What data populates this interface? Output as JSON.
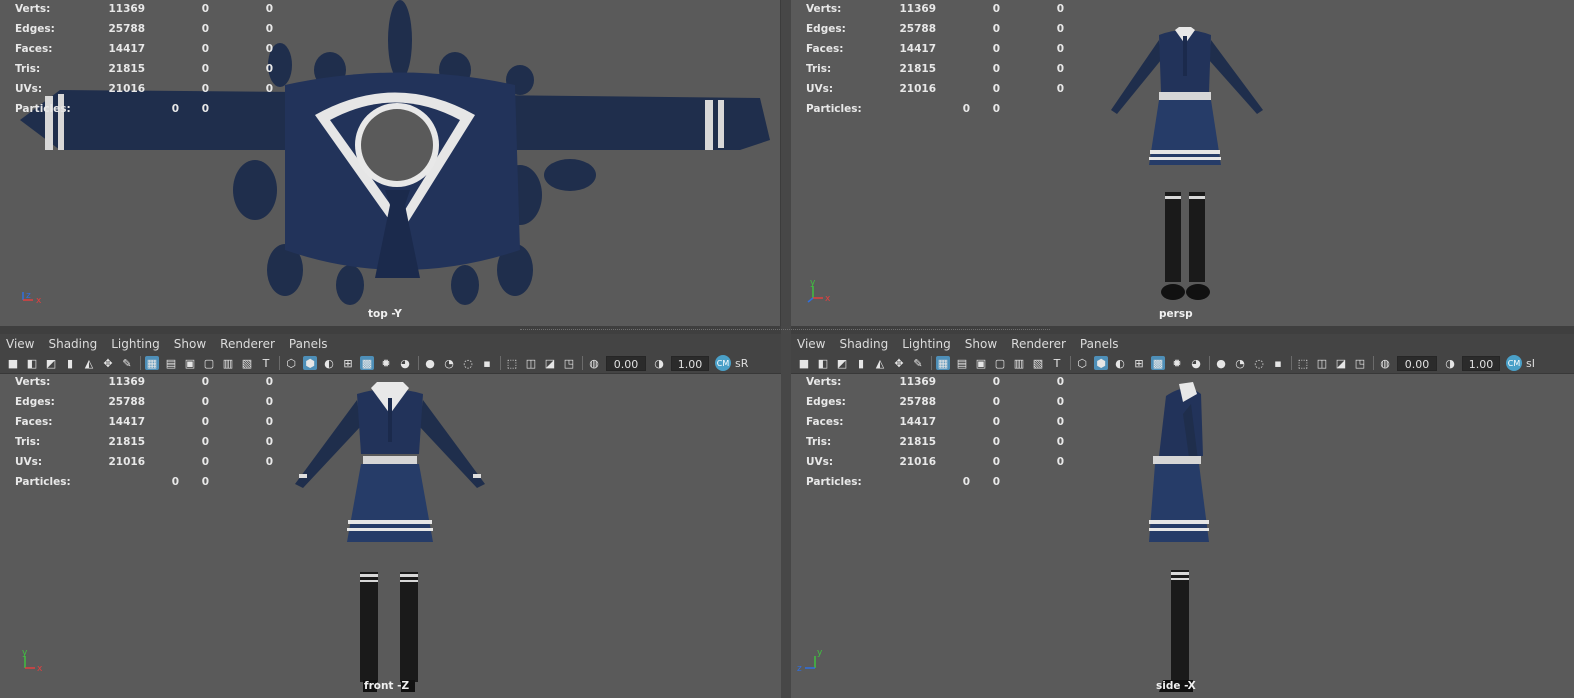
{
  "hud": {
    "rows": [
      {
        "label": "Verts:",
        "v1": "11369",
        "v2": "0",
        "v3": "0"
      },
      {
        "label": "Edges:",
        "v1": "25788",
        "v2": "0",
        "v3": "0"
      },
      {
        "label": "Faces:",
        "v1": "14417",
        "v2": "0",
        "v3": "0"
      },
      {
        "label": "Tris:",
        "v1": "21815",
        "v2": "0",
        "v3": "0"
      },
      {
        "label": "UVs:",
        "v1": "21016",
        "v2": "0",
        "v3": "0"
      }
    ],
    "particles": {
      "label": "Particles:",
      "v1": "0",
      "v2": "0"
    }
  },
  "viewports": {
    "top": {
      "camera": "top -Y",
      "axis": [
        "z",
        "x"
      ]
    },
    "persp": {
      "camera": "persp",
      "axis": [
        "y",
        "x"
      ]
    },
    "front": {
      "camera": "front -Z",
      "axis": [
        "y",
        "x"
      ]
    },
    "side": {
      "camera": "side -X",
      "axis": [
        "y",
        "z"
      ]
    }
  },
  "panel_menu": [
    "View",
    "Shading",
    "Lighting",
    "Show",
    "Renderer",
    "Panels"
  ],
  "toolbar": {
    "near_clip_value": "0.00",
    "gamma_value": "1.00",
    "color_mgmt_badge": "CM",
    "color_space_left": "sR",
    "color_space_right": "sI"
  },
  "colors": {
    "viewport_bg": "#5a5a5a",
    "panel_bg": "#444444",
    "accent": "#4e8fb8",
    "uniform_navy": "#1f3050",
    "uniform_white": "#e8e8e8",
    "socks_black": "#1a1a1a"
  }
}
